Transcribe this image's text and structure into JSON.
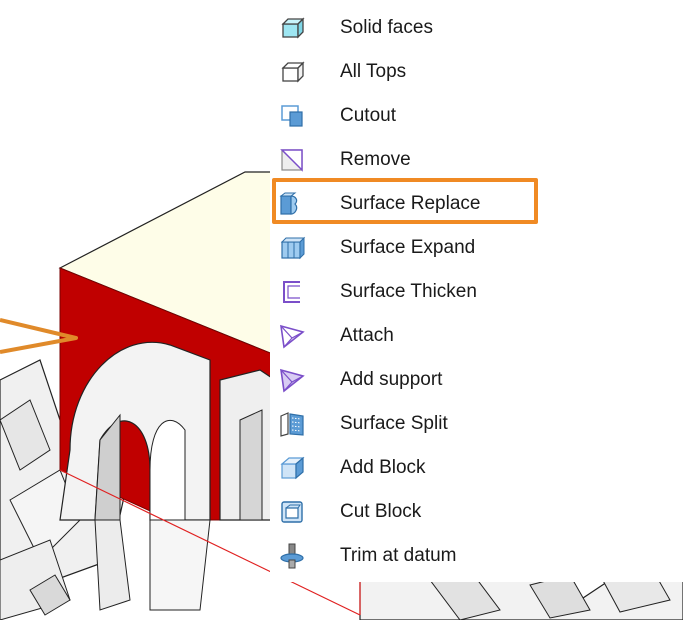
{
  "menu": {
    "items": [
      {
        "label": "Solid faces",
        "icon": "solid-faces-icon"
      },
      {
        "label": "All Tops",
        "icon": "all-tops-icon"
      },
      {
        "label": "Cutout",
        "icon": "cutout-icon"
      },
      {
        "label": "Remove",
        "icon": "remove-icon"
      },
      {
        "label": "Surface Replace",
        "icon": "surface-replace-icon"
      },
      {
        "label": "Surface Expand",
        "icon": "surface-expand-icon"
      },
      {
        "label": "Surface Thicken",
        "icon": "surface-thicken-icon"
      },
      {
        "label": "Attach",
        "icon": "attach-icon"
      },
      {
        "label": "Add support",
        "icon": "add-support-icon"
      },
      {
        "label": "Surface Split",
        "icon": "surface-split-icon"
      },
      {
        "label": "Add Block",
        "icon": "add-block-icon"
      },
      {
        "label": "Cut Block",
        "icon": "cut-block-icon"
      },
      {
        "label": "Trim at datum",
        "icon": "trim-at-datum-icon"
      }
    ],
    "highlighted_item": "Surface Replace"
  },
  "colors": {
    "highlight": "#f08a24",
    "face_red": "#c00000",
    "face_top": "#fefde8",
    "icon_blue": "#5b9bd5",
    "icon_purple": "#7b4fc9"
  }
}
